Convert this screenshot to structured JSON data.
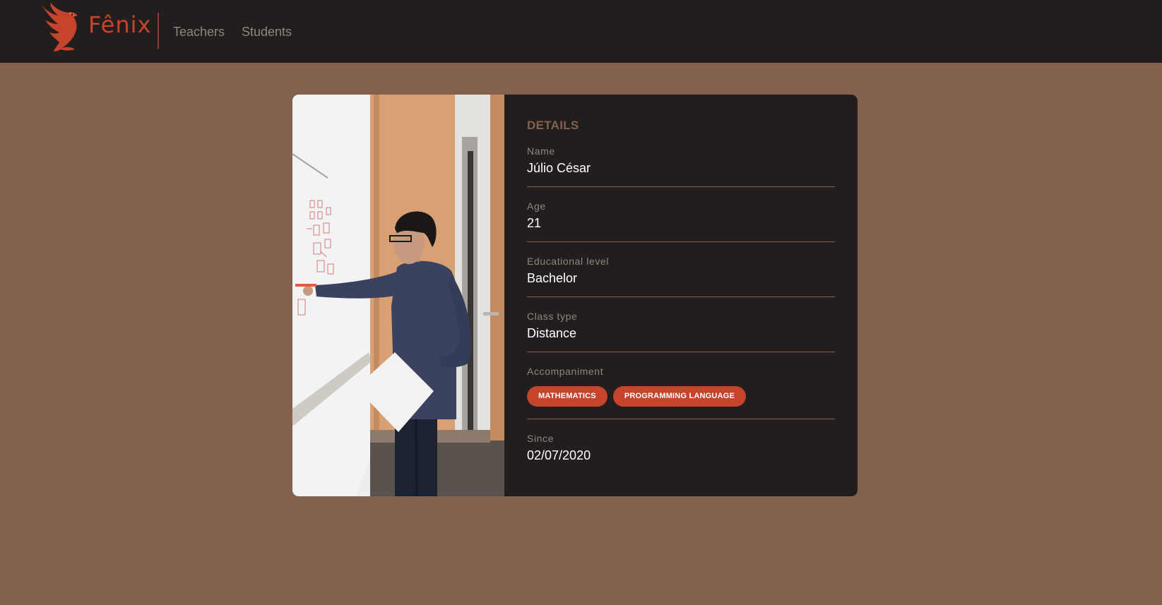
{
  "app": {
    "name": "Fênix",
    "accent": "#c6432c",
    "background": "#84614d",
    "surface": "#221e1e"
  },
  "nav": {
    "items": [
      {
        "label": "Teachers"
      },
      {
        "label": "Students"
      }
    ]
  },
  "details": {
    "title": "DETAILS",
    "fields": [
      {
        "label": "Name",
        "value": "Júlio César"
      },
      {
        "label": "Age",
        "value": "21"
      },
      {
        "label": "Educational level",
        "value": "Bachelor"
      },
      {
        "label": "Class type",
        "value": "Distance"
      },
      {
        "label": "Accompaniment",
        "chips": [
          "MATHEMATICS",
          "PROGRAMMING LANGUAGE"
        ]
      },
      {
        "label": "Since",
        "value": "02/07/2020"
      }
    ]
  },
  "photo": {
    "icon": "teacher-photo"
  }
}
